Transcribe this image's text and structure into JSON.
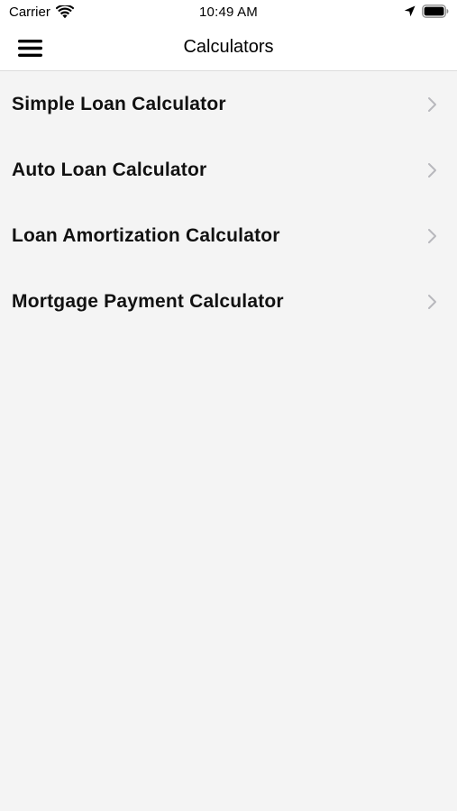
{
  "status_bar": {
    "carrier": "Carrier",
    "time": "10:49 AM",
    "icons": [
      "wifi-icon",
      "location-icon",
      "battery-icon"
    ]
  },
  "nav": {
    "title": "Calculators",
    "menu_icon": "hamburger-icon"
  },
  "list": {
    "items": [
      {
        "label": "Simple Loan Calculator"
      },
      {
        "label": "Auto Loan Calculator"
      },
      {
        "label": "Loan Amortization Calculator"
      },
      {
        "label": "Mortgage Payment Calculator"
      }
    ],
    "chevron_icon": "chevron-right-icon"
  },
  "colors": {
    "background": "#f4f4f4",
    "bar_background": "#ffffff",
    "chevron": "#b8b8bd",
    "text": "#111111"
  }
}
